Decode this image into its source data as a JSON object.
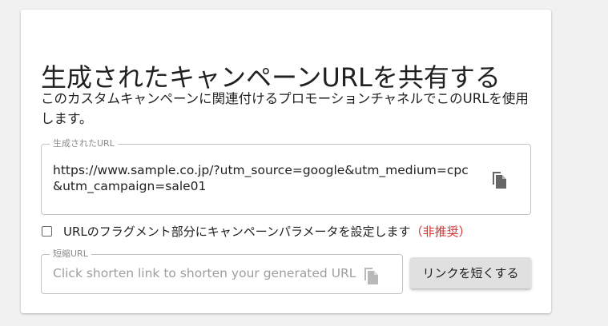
{
  "card": {
    "title": "生成されたキャンペーンURLを共有する",
    "description": "このカスタムキャンペーンに関連付けるプロモーションチャネルでこのURLを使用します。"
  },
  "generated_url": {
    "label": "生成されたURL",
    "value": "https://www.sample.co.jp/?utm_source=google&utm_medium=cpc&utm_campaign=sale01",
    "copy_icon": "copy-icon"
  },
  "fragment_option": {
    "checked": false,
    "label": "URLのフラグメント部分にキャンペーンパラメータを設定します",
    "warning": "（非推奨）"
  },
  "short_url": {
    "label": "短縮URL",
    "placeholder": "Click shorten link to shorten your generated URL.",
    "value": "",
    "copy_icon": "copy-icon"
  },
  "shorten_button": {
    "label": "リンクを短くする"
  },
  "colors": {
    "warning": "#d32f2f",
    "button_bg": "#e0e0e0",
    "border": "#c4c4c4",
    "icon": "#666666"
  }
}
